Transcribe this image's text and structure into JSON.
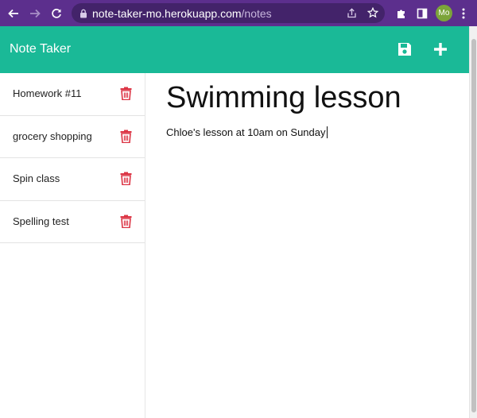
{
  "browser": {
    "url_host": "note-taker-mo.herokuapp.com",
    "url_path": "/notes",
    "profile_initials": "Mo"
  },
  "header": {
    "title": "Note Taker",
    "save_icon": "save-icon",
    "new_icon": "plus-icon"
  },
  "notes": [
    {
      "title": "Homework #11"
    },
    {
      "title": "grocery shopping"
    },
    {
      "title": "Spin class"
    },
    {
      "title": "Spelling test"
    }
  ],
  "active_note": {
    "title": "Swimming lesson",
    "text": "Chloe's lesson at 10am on Sunday"
  },
  "colors": {
    "browser_frame": "#5c2f8d",
    "header": "#1ab997",
    "trash": "#dc3545"
  }
}
